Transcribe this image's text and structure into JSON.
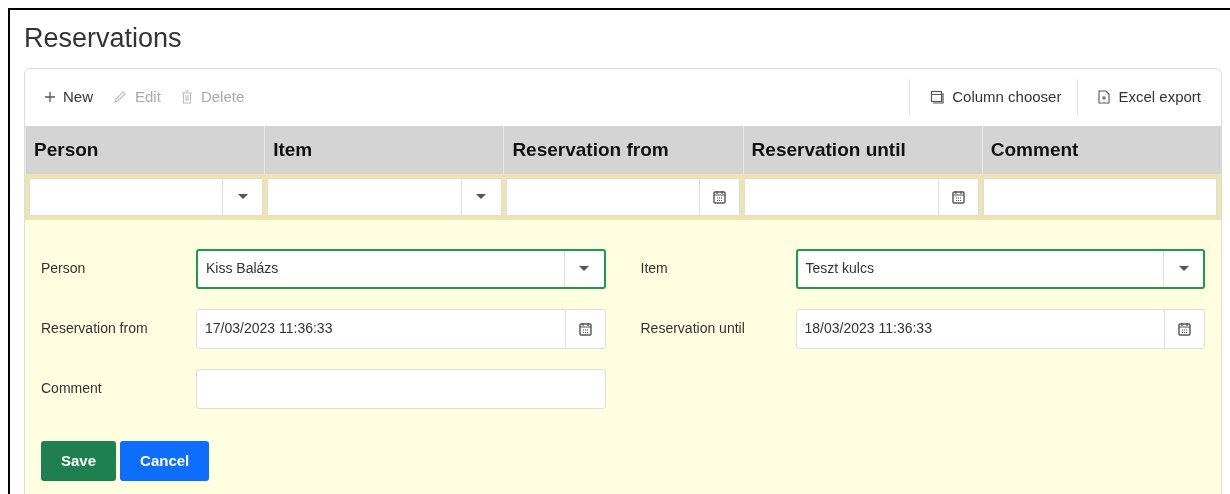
{
  "title": "Reservations",
  "toolbar": {
    "left": [
      {
        "label": "New",
        "kind": "new",
        "disabled": false
      },
      {
        "label": "Edit",
        "kind": "edit",
        "disabled": true
      },
      {
        "label": "Delete",
        "kind": "delete",
        "disabled": true
      }
    ],
    "right": [
      {
        "label": "Column chooser",
        "kind": "columns",
        "disabled": false
      },
      {
        "label": "Excel export",
        "kind": "export",
        "disabled": false
      }
    ]
  },
  "table": {
    "columns": [
      {
        "label": "Person",
        "kind": "dropdown"
      },
      {
        "label": "Item",
        "kind": "dropdown"
      },
      {
        "label": "Reservation from",
        "kind": "date"
      },
      {
        "label": "Reservation until",
        "kind": "date"
      },
      {
        "label": "Comment",
        "kind": "text"
      }
    ]
  },
  "form": {
    "fields": [
      {
        "label": "Person",
        "value": "Kiss Balázs",
        "kind": "dropdown",
        "highlighted": true
      },
      {
        "label": "Item",
        "value": "Teszt kulcs",
        "kind": "dropdown",
        "highlighted": true
      },
      {
        "label": "Reservation from",
        "value": "17/03/2023 11:36:33",
        "kind": "date",
        "highlighted": false
      },
      {
        "label": "Reservation until",
        "value": "18/03/2023 11:36:33",
        "kind": "date",
        "highlighted": false
      },
      {
        "label": "Comment",
        "kind": "text",
        "highlighted": false
      }
    ],
    "buttons": [
      {
        "label": "Save",
        "kind": "primary"
      },
      {
        "label": "Cancel",
        "kind": "secondary"
      }
    ]
  }
}
